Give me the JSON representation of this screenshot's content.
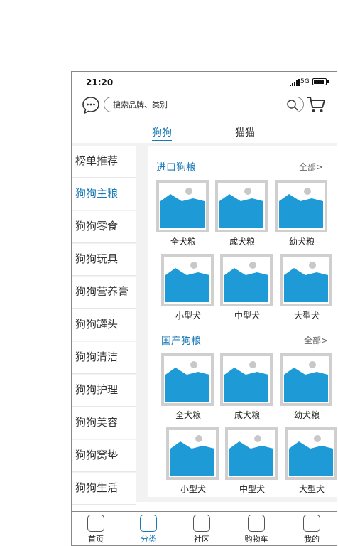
{
  "status": {
    "time": "21:20",
    "network": "5G"
  },
  "search": {
    "placeholder": "搜索品牌、类别"
  },
  "tabs": [
    {
      "label": "狗狗",
      "active": true
    },
    {
      "label": "猫猫",
      "active": false
    }
  ],
  "sidebar": {
    "items": [
      {
        "label": "榜单推荐"
      },
      {
        "label": "狗狗主粮",
        "active": true
      },
      {
        "label": "狗狗零食"
      },
      {
        "label": "狗狗玩具"
      },
      {
        "label": "狗狗营养膏"
      },
      {
        "label": "狗狗罐头"
      },
      {
        "label": "狗狗清洁"
      },
      {
        "label": "狗狗护理"
      },
      {
        "label": "狗狗美容"
      },
      {
        "label": "狗狗窝垫"
      },
      {
        "label": "狗狗生活"
      }
    ]
  },
  "sections": [
    {
      "title": "进口狗粮",
      "more": "全部>",
      "items": [
        "全犬粮",
        "成犬粮",
        "幼犬粮",
        "小型犬",
        "中型犬",
        "大型犬"
      ]
    },
    {
      "title": "国产狗粮",
      "more": "全部>",
      "items": [
        "全犬粮",
        "成犬粮",
        "幼犬粮",
        "小型犬",
        "中型犬",
        "大型犬"
      ]
    }
  ],
  "bottom_nav": [
    {
      "label": "首页"
    },
    {
      "label": "分类",
      "active": true
    },
    {
      "label": "社区"
    },
    {
      "label": "购物车"
    },
    {
      "label": "我的"
    }
  ],
  "colors": {
    "accent": "#1a7ab5",
    "image_blue": "#1e9bd7",
    "placeholder_border": "#cfcfcf"
  }
}
